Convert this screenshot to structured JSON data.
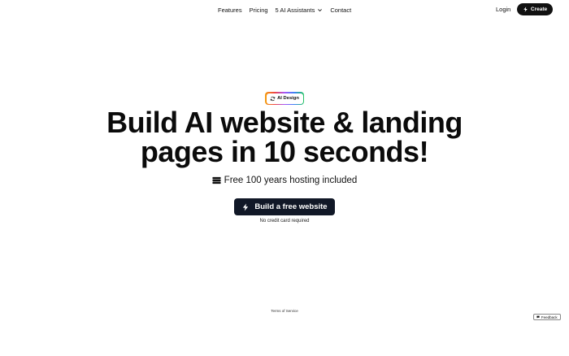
{
  "nav": {
    "links": [
      "Features",
      "Pricing",
      "5 AI Assistants",
      "Contact"
    ],
    "login_label": "Login",
    "create_label": "Create"
  },
  "hero": {
    "badge_label": "AI Design",
    "headline_line1": "Build AI website & landing",
    "headline_line2": "pages in 10 seconds!",
    "hosting_text": "Free 100 years hosting included",
    "cta_label": "Build a free website",
    "cta_note": "No credit card required"
  },
  "footer": {
    "terms_label": "Terms of Service",
    "feedback_label": "Feedback"
  },
  "colors": {
    "cta_bg": "#111827",
    "create_bg": "#111111"
  },
  "icons": {
    "create": "lightning-icon",
    "badge": "refresh-icon",
    "hosting": "server-icon",
    "cta": "lightning-icon",
    "feedback": "chat-icon",
    "dropdown": "chevron-down-icon"
  }
}
